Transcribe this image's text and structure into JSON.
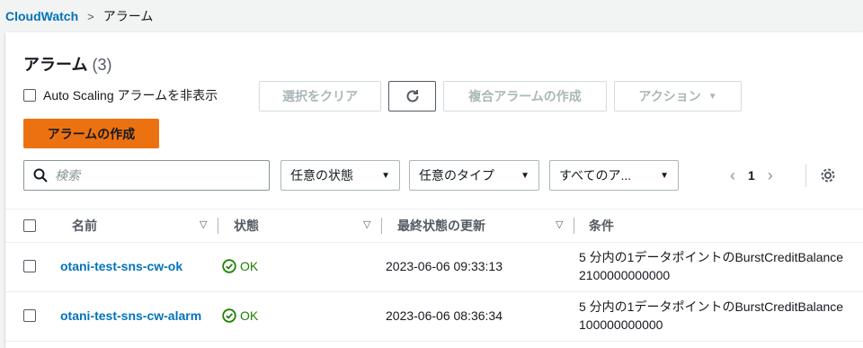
{
  "breadcrumb": {
    "root": "CloudWatch",
    "separator": ">",
    "current": "アラーム"
  },
  "header": {
    "title": "アラーム",
    "count": "(3)"
  },
  "toolbar": {
    "asg_label": "Auto Scaling アラームを非表示",
    "clear_selection": "選択をクリア",
    "composite": "複合アラームの作成",
    "actions": "アクション",
    "create": "アラームの作成"
  },
  "filters": {
    "search_placeholder": "検索",
    "state": "任意の状態",
    "type": "任意のタイプ",
    "actions": "すべてのア..."
  },
  "pagination": {
    "page": "1"
  },
  "table": {
    "columns": [
      "名前",
      "状態",
      "最終状態の更新",
      "条件"
    ],
    "rows": [
      {
        "name": "otani-test-sns-cw-ok",
        "state": "OK",
        "updated": "2023-06-06 09:33:13",
        "cond1": "5 分内の1データポイントのBurstCreditBalance",
        "cond2": "2100000000000"
      },
      {
        "name": "otani-test-sns-cw-alarm",
        "state": "OK",
        "updated": "2023-06-06 08:36:34",
        "cond1": "5 分内の1データポイントのBurstCreditBalance",
        "cond2": "100000000000"
      }
    ]
  },
  "colors": {
    "link": "#0073bb",
    "primary": "#ec7211",
    "ok": "#1d8102"
  }
}
